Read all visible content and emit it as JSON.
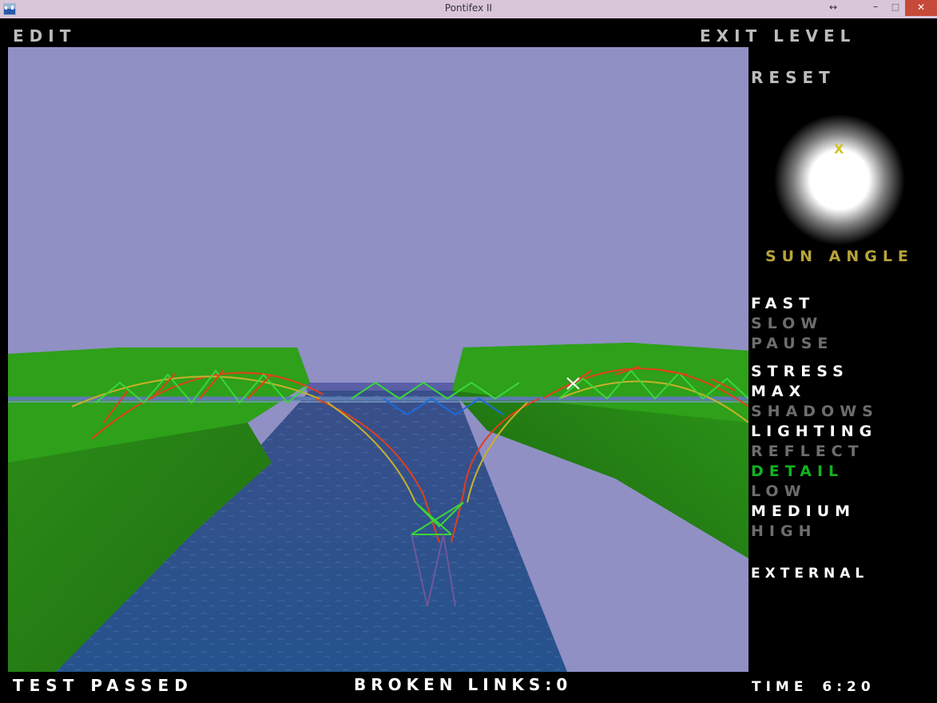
{
  "window": {
    "title": "Pontifex II",
    "icons": {
      "app": "bridge-app-icon",
      "resize": "resize-arrows-icon",
      "minimize": "minimize-icon",
      "maximize": "maximize-icon",
      "close": "close-icon"
    }
  },
  "menu": {
    "edit": "Edit",
    "exit_level": "Exit Level",
    "reset": "Reset",
    "sun_angle": "Sun Angle",
    "sun_marker": "X",
    "speed": {
      "fast": "Fast",
      "slow": "Slow",
      "pause": "Pause"
    },
    "view": {
      "stress": "Stress",
      "max": "Max",
      "shadows": "Shadows",
      "lighting": "Lighting",
      "reflect": "Reflect",
      "detail": "Detail",
      "low": "Low",
      "medium": "Medium",
      "high": "High"
    },
    "external": "External"
  },
  "status": {
    "result": "Test Passed",
    "broken_links_label": "Broken Links:",
    "broken_links_value": "0",
    "time_label": "Time",
    "time_value": "6:20"
  },
  "colors": {
    "sky": "#9090c4",
    "grass": "#2fa01a",
    "water": "#2a4f86",
    "stress_high": "#e0401a",
    "stress_mid": "#c8c82a",
    "stress_low": "#3ad63a",
    "deck": "#1f6ad8",
    "menu_active": "#ffffff",
    "menu_inactive": "#6d6d6d",
    "menu_heading": "#11b21f",
    "sun_label": "#b7a43a"
  }
}
